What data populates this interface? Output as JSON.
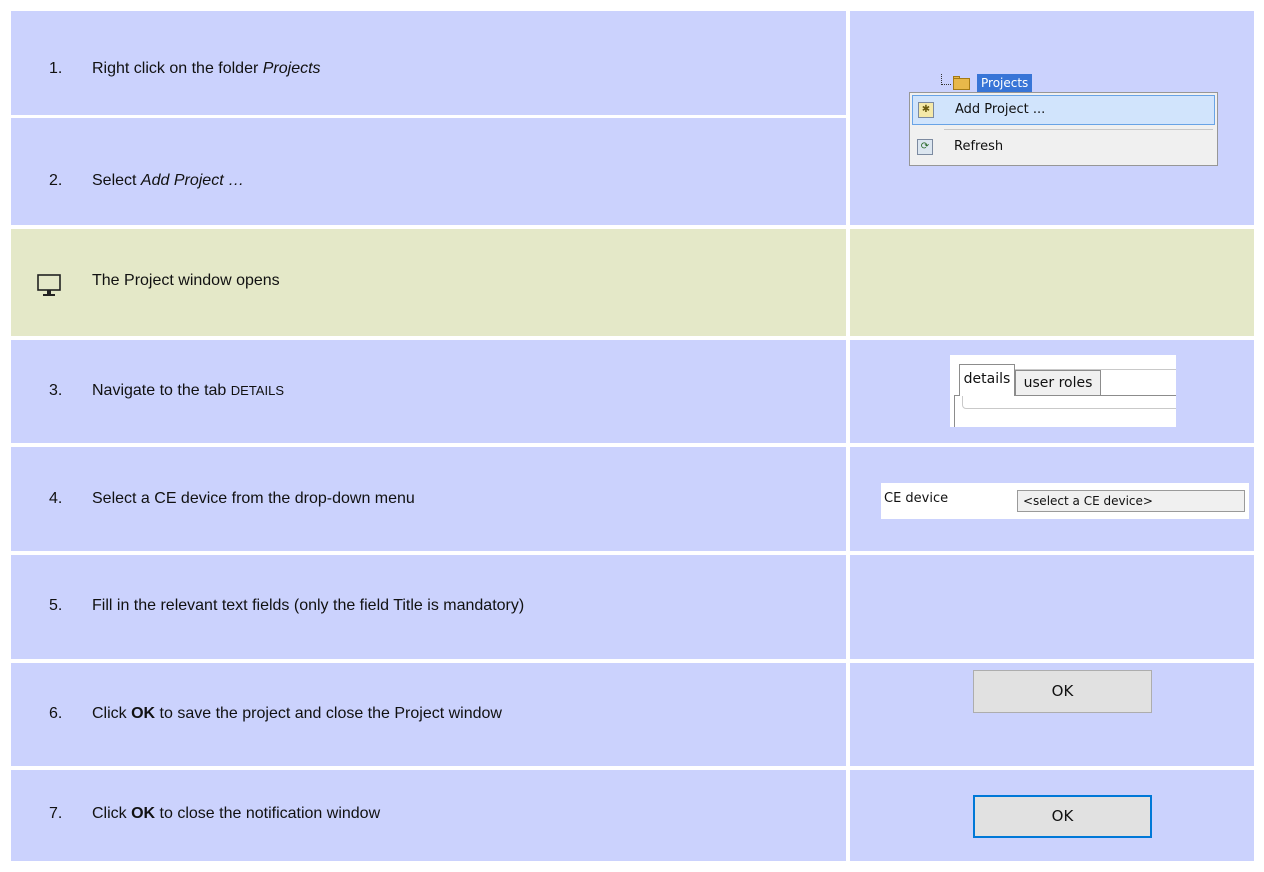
{
  "rows": [
    {
      "num": "1.",
      "pre": "Right click on the folder ",
      "em": "Projects",
      "post": ""
    },
    {
      "num": "2.",
      "pre": "Select ",
      "em": "Add Project …",
      "post": ""
    },
    {
      "num": "",
      "text": "The Project window opens"
    },
    {
      "num": "3.",
      "pre": "Navigate to the tab ",
      "small": "DETAILS"
    },
    {
      "num": "4.",
      "text": "Select a CE device from the drop-down menu"
    },
    {
      "num": "5.",
      "text": "Fill in the relevant text fields (only the field Title is mandatory)"
    },
    {
      "num": "6.",
      "pre": "Click ",
      "bold": "OK",
      "post": " to save the project and close the Project window"
    },
    {
      "num": "7.",
      "pre": "Click ",
      "bold": "OK",
      "post": " to close the notification window"
    }
  ],
  "snippets": {
    "tree_folder": "Projects",
    "menu_items": [
      "Add Project ...",
      "Refresh"
    ],
    "tabs": [
      "details",
      "user roles"
    ],
    "ce_label": "CE device",
    "ce_select": "<select a CE device>",
    "ok_save": "OK",
    "ok_notify": "OK"
  },
  "colors": {
    "step_row": "#cbd2fd",
    "info_row": "#e4e8c8"
  },
  "icons": {
    "info_row": "monitor-icon"
  }
}
